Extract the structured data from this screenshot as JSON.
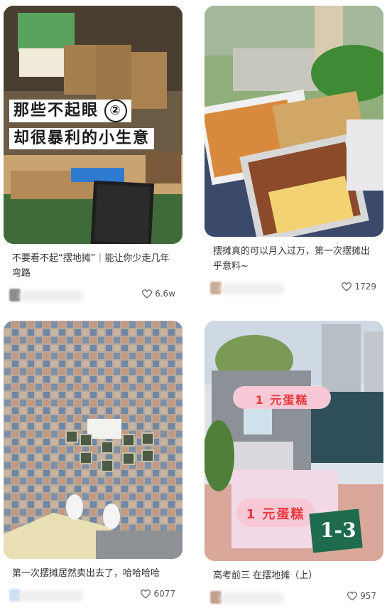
{
  "cards": [
    {
      "overlay": {
        "line1": "那些不起眼",
        "circled": "②",
        "line2": "却很暴利的小生意"
      },
      "title": "不要看不起“摆地摊”｜能让你少走几年弯路",
      "likes": "6.6w"
    },
    {
      "title": "摆摊真的可以月入过万，第一次摆摊出乎意料~",
      "likes": "1729"
    },
    {
      "title": "第一次摆摊居然卖出去了，哈哈哈哈",
      "likes": "6077"
    },
    {
      "sign_top": "1 元蛋糕",
      "sign_bottom": "1 元蛋糕",
      "chalkboard": "1-3",
      "title": "高考前三 在摆地摊（上）",
      "likes": "957"
    }
  ],
  "icons": {
    "like": "heart-outline-icon"
  },
  "colors": {
    "text": "#333333",
    "likes": "#555555",
    "sign_pink": "#e8393f"
  }
}
